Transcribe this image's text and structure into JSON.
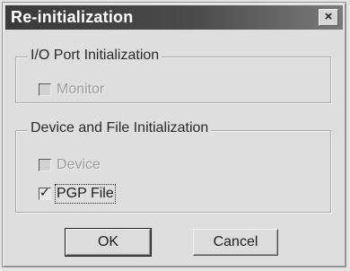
{
  "window": {
    "title": "Re-initialization",
    "close_label": "×"
  },
  "io_port_group": {
    "label": "I/O Port Initialization",
    "option": {
      "label": "Monitor",
      "checked": false,
      "disabled": true
    }
  },
  "device_file_group": {
    "label": "Device and File Initialization",
    "options": [
      {
        "label": "Device",
        "checked": false,
        "disabled": true
      },
      {
        "label": "PGP File",
        "checked": true,
        "disabled": false
      }
    ]
  },
  "buttons": {
    "ok_label": "OK",
    "cancel_label": "Cancel"
  },
  "checkmark_glyph": "✓"
}
